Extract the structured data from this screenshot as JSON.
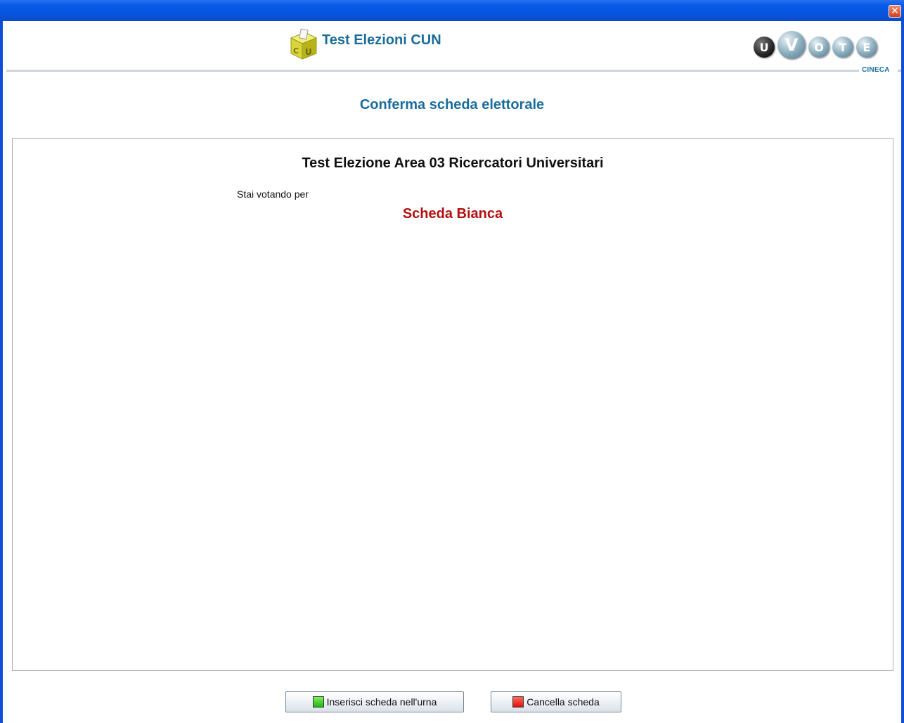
{
  "window": {
    "close_glyph": "✕"
  },
  "header": {
    "app_title": "Test Elezioni CUN",
    "logo_letters": [
      "U",
      "V",
      "O",
      "T",
      "E"
    ],
    "brand_sub": "CINECA",
    "ballot_box_icon": "ballot-box-icon"
  },
  "page": {
    "title": "Conferma scheda elettorale"
  },
  "ballot": {
    "election_title": "Test Elezione Area 03 Ricercatori Universitari",
    "voting_for_label": "Stai votando per",
    "choice": "Scheda Bianca"
  },
  "actions": {
    "insert_label": "Inserisci scheda nell'urna",
    "cancel_label": "Cancella scheda"
  },
  "colors": {
    "accent": "#1a6d9a",
    "choice": "#b21010",
    "titlebar": "#0a5ae8"
  }
}
